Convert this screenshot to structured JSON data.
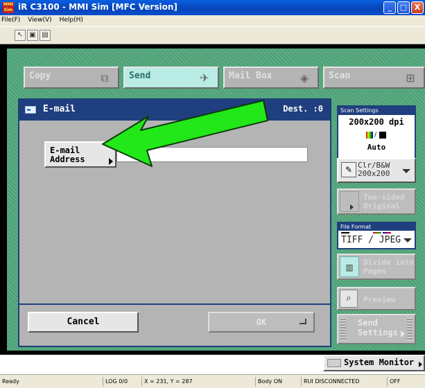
{
  "window": {
    "title": "iR C3100 - MMI Sim [MFC Version]",
    "app_icon_text": "MMI Sim",
    "controls": {
      "minimize": "_",
      "maximize": "□",
      "close": "X"
    }
  },
  "menu": {
    "items": [
      "File(F)",
      "View(V)",
      "Help(H)"
    ]
  },
  "toolbar": {
    "icons": [
      "pointer-icon",
      "image-icon",
      "document-icon"
    ]
  },
  "function_tabs": [
    {
      "label": "Copy",
      "icon": "copy-icon",
      "active": false
    },
    {
      "label": "Send",
      "icon": "paper-plane-icon",
      "active": true
    },
    {
      "label": "Mail Box",
      "icon": "mailbox-icon",
      "active": false
    },
    {
      "label": "Scan",
      "icon": "scanner-icon",
      "active": false
    }
  ],
  "dialog": {
    "title": "E-mail",
    "dest": "Dest. :0",
    "address_button": {
      "line1": "E-mail",
      "line2": "Address"
    },
    "address_value": "",
    "cancel": "Cancel",
    "ok": "OK"
  },
  "scan_settings": {
    "header": "Scan Settings",
    "resolution": "200x200 dpi",
    "color_mode": "Auto",
    "mode_button": {
      "line1": "Clr/B&W",
      "line2": "200x200"
    }
  },
  "two_sided": {
    "line1": "Two-sided",
    "line2": "Original"
  },
  "file_format": {
    "header": "File Format",
    "value": "TIFF / JPEG"
  },
  "divide": {
    "line1": "Divide into",
    "line2": "Pages"
  },
  "preview": {
    "label": "Preview"
  },
  "send_settings": {
    "line1": "Send",
    "line2": "Settings"
  },
  "system_monitor": "System Monitor",
  "status_bar": {
    "ready": "Ready",
    "log": "LOG 0/0",
    "coords": "X = 231, Y = 287",
    "body": "Body ON",
    "rui": "RUI DISCONNECTED",
    "off": "OFF"
  },
  "colors": {
    "title_blue": "#0a5fe0",
    "panel_green": "#5cae84",
    "dialog_header": "#1f3f7e",
    "active_tab": "#b8ece4",
    "arrow_green": "#22e81a"
  }
}
